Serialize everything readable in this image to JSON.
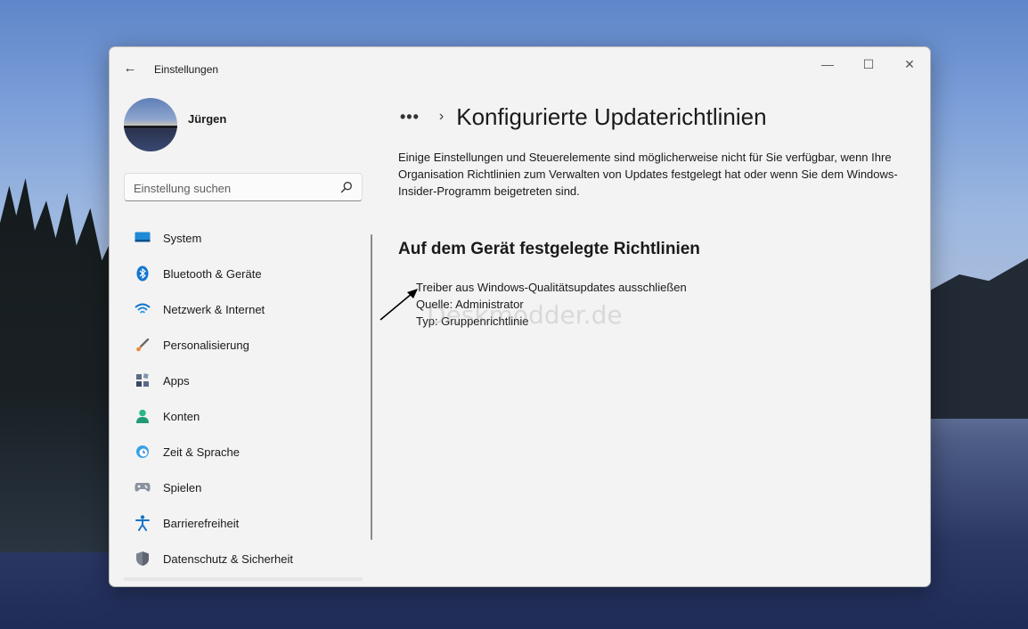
{
  "window": {
    "app_title": "Einstellungen",
    "back_glyph": "←",
    "min_glyph": "—",
    "max_glyph": "☐",
    "close_glyph": "✕"
  },
  "user": {
    "name": "Jürgen"
  },
  "search": {
    "placeholder": "Einstellung suchen"
  },
  "sidebar": {
    "items": [
      {
        "label": "System",
        "icon": "system-icon",
        "color": "#0078d4"
      },
      {
        "label": "Bluetooth & Geräte",
        "icon": "bluetooth-icon",
        "color": "#0078d4"
      },
      {
        "label": "Netzwerk & Internet",
        "icon": "wifi-icon",
        "color": "#0078d4"
      },
      {
        "label": "Personalisierung",
        "icon": "brush-icon",
        "color": "#e0743a"
      },
      {
        "label": "Apps",
        "icon": "apps-icon",
        "color": "#4a5a78"
      },
      {
        "label": "Konten",
        "icon": "account-icon",
        "color": "#2bb58a"
      },
      {
        "label": "Zeit & Sprache",
        "icon": "clock-globe-icon",
        "color": "#1f8ad6"
      },
      {
        "label": "Spielen",
        "icon": "gamepad-icon",
        "color": "#7a8290"
      },
      {
        "label": "Barrierefreiheit",
        "icon": "accessibility-icon",
        "color": "#1a73c8"
      },
      {
        "label": "Datenschutz & Sicherheit",
        "icon": "shield-icon",
        "color": "#6e7480"
      }
    ]
  },
  "main": {
    "breadcrumb_more": "•••",
    "breadcrumb_sep": "›",
    "title": "Konfigurierte Updaterichtlinien",
    "description": "Einige Einstellungen und Steuerelemente sind möglicherweise nicht für Sie verfügbar, wenn Ihre Organisation Richtlinien zum Verwalten von Updates festgelegt hat oder wenn Sie dem Windows-Insider-Programm beigetreten sind.",
    "section_title": "Auf dem Gerät festgelegte Richtlinien",
    "policy": {
      "name": "Treiber aus Windows-Qualitätsupdates ausschließen",
      "source": "Quelle: Administrator",
      "type": "Typ: Gruppenrichtlinie"
    },
    "watermark": "Deskmodder.de"
  }
}
